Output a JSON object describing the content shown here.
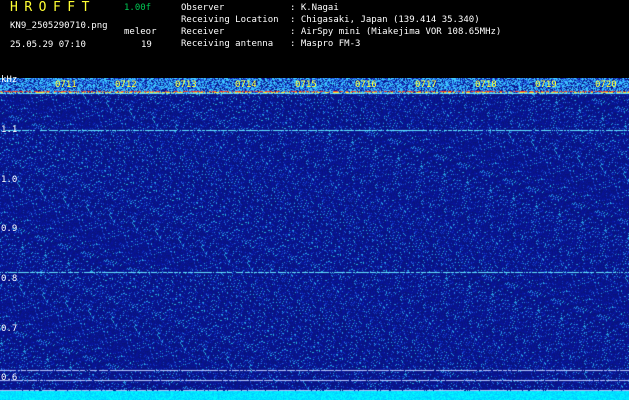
{
  "header": {
    "app_title": "HROFFT",
    "version": "1.00f",
    "filename": "KN9_2505290710.png",
    "date": "25.05.29 07:10",
    "meleor_label": "meleor",
    "meleor_count": "19",
    "info": [
      {
        "label": "Observer",
        "value": ": K.Nagai"
      },
      {
        "label": "Receiving Location",
        "value": ": Chigasaki, Japan (139.414 35.340)"
      },
      {
        "label": "Receiver",
        "value": ": AirSpy mini (Miakejima VOR 108.65MHz)"
      },
      {
        "label": "Receiving antenna",
        "value": ": Maspro FM-3"
      }
    ]
  },
  "spectrogram": {
    "y_unit": "kHz",
    "y_ticks": [
      "1.1",
      "1.0",
      "0.9",
      "0.8",
      "0.7",
      "0.6"
    ],
    "time_labels": [
      "0711",
      "0712",
      "0713",
      "0714",
      "0715",
      "0716",
      "0717",
      "0718",
      "0719",
      "0720"
    ]
  },
  "colors": {
    "background": "#000000",
    "header_text": "#ffffff",
    "title": "#ffff33",
    "version": "#00c853",
    "time_label": "#ffff33"
  }
}
